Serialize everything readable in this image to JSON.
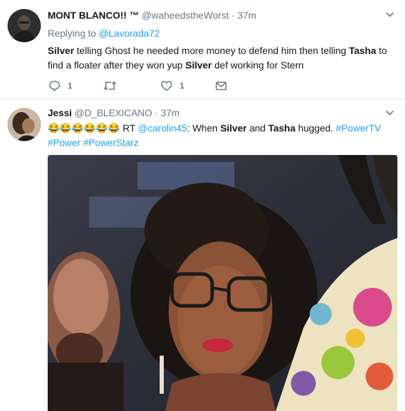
{
  "tweets": [
    {
      "name": "MONT BLANCO!! ™",
      "handle": "@waheedstheWorst",
      "separator": "·",
      "time": "37m",
      "replying_prefix": "Replying to",
      "replying_to": "@Lavorada72",
      "text_parts": {
        "p1": "Silver",
        "p2": " telling Ghost he needed more money to defend him then telling ",
        "p3": "Tasha",
        "p4": " to find a floater after they won yup ",
        "p5": "Silver",
        "p6": " def working for Stern"
      },
      "actions": {
        "reply_count": "1",
        "retweet_count": "",
        "like_count": "1"
      }
    },
    {
      "name": "Jessi",
      "handle": "@D_BLEXICANO",
      "separator": "·",
      "time": "37m",
      "text_parts": {
        "emojis": "😂😂😂😂😂😂",
        "rt": " RT ",
        "mention": "@carolin45",
        "p1": ": When ",
        "p2": "Silver",
        "p3": " and ",
        "p4": "Tasha",
        "p5": " hugged. ",
        "tag1": "#PowerTV",
        "tag2": "#Power",
        "tag3": "#PowerStarz"
      }
    }
  ],
  "colors": {
    "link": "#1da1f2",
    "secondary_text": "#657786",
    "primary_text": "#14171a"
  },
  "icons": [
    "chevron-down-icon",
    "reply-icon",
    "retweet-icon",
    "heart-icon",
    "envelope-icon"
  ]
}
